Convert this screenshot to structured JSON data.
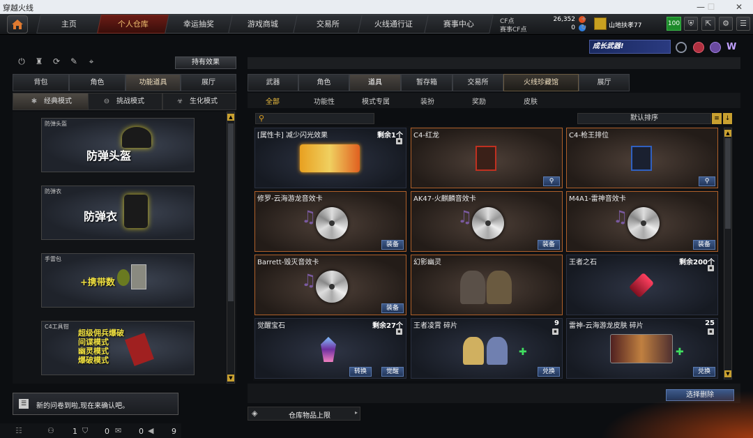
{
  "window": {
    "title": "穿越火线"
  },
  "nav": {
    "tabs": [
      "主页",
      "个人仓库",
      "幸运抽奖",
      "游戏商城",
      "交易所",
      "火线通行证",
      "赛事中心"
    ],
    "active": 1
  },
  "cf": {
    "cf_label": "CF点",
    "cf_value": "26,352",
    "match_label": "赛事CF点",
    "match_value": "0"
  },
  "user": {
    "name": "山地扶孝77",
    "level_badge": "100"
  },
  "banner": {
    "text": "成长武器!"
  },
  "left": {
    "effect_button": "持有效果",
    "tabs": [
      "背包",
      "角色",
      "功能道具",
      "展厅"
    ],
    "active_tab": 2,
    "modes": [
      "经典模式",
      "挑战模式",
      "生化模式"
    ],
    "active_mode": 0,
    "items": [
      {
        "label": "防弹头盔",
        "title": "防弹头盔"
      },
      {
        "label": "防弹衣",
        "title": "防弹衣"
      },
      {
        "label": "手雷包",
        "title": "+携带数"
      },
      {
        "label": "C4工具钳",
        "lines": [
          "超级佣兵爆破",
          "间谍模式",
          "幽灵模式",
          "爆破模式"
        ]
      }
    ],
    "notice": "新的问卷到啦,现在来确认吧。",
    "bottom_counts": [
      "1",
      "0",
      "0",
      "9"
    ]
  },
  "right": {
    "tabs": [
      "武器",
      "角色",
      "道具",
      "暂存箱",
      "交易所",
      "火线珍藏馆",
      "展厅"
    ],
    "active_tab": 2,
    "subtabs": [
      "全部",
      "功能性",
      "模式专属",
      "装扮",
      "奖励",
      "皮肤"
    ],
    "active_subtab": 0,
    "search_placeholder": "",
    "sort_label": "默认排序",
    "cards": [
      {
        "name": "[属性卡] 减少闪光效果",
        "count": "剩余1个",
        "action": ""
      },
      {
        "name": "C4-红龙",
        "count": "",
        "action": ""
      },
      {
        "name": "C4-枪王排位",
        "count": "",
        "action": ""
      },
      {
        "name": "修罗-云海游龙音效卡",
        "count": "",
        "action": "装备"
      },
      {
        "name": "AK47-火麒麟音效卡",
        "count": "",
        "action": "装备"
      },
      {
        "name": "M4A1-雷神音效卡",
        "count": "",
        "action": "装备"
      },
      {
        "name": "Barrett-毁灭音效卡",
        "count": "",
        "action": "装备"
      },
      {
        "name": "幻影幽灵",
        "count": "",
        "action": ""
      },
      {
        "name": "王者之石",
        "count": "剩余200个",
        "action": ""
      },
      {
        "name": "觉醒宝石",
        "count": "剩余27个",
        "action": "觉醒",
        "action2": "转换"
      },
      {
        "name": "王者凌霄 碎片",
        "count": "9",
        "action": "兑换"
      },
      {
        "name": "雷神-云海游龙皮肤 碎片",
        "count": "25",
        "action": "兑换"
      }
    ],
    "delete_button": "选择删除",
    "capacity_label": "仓库物品上限"
  }
}
